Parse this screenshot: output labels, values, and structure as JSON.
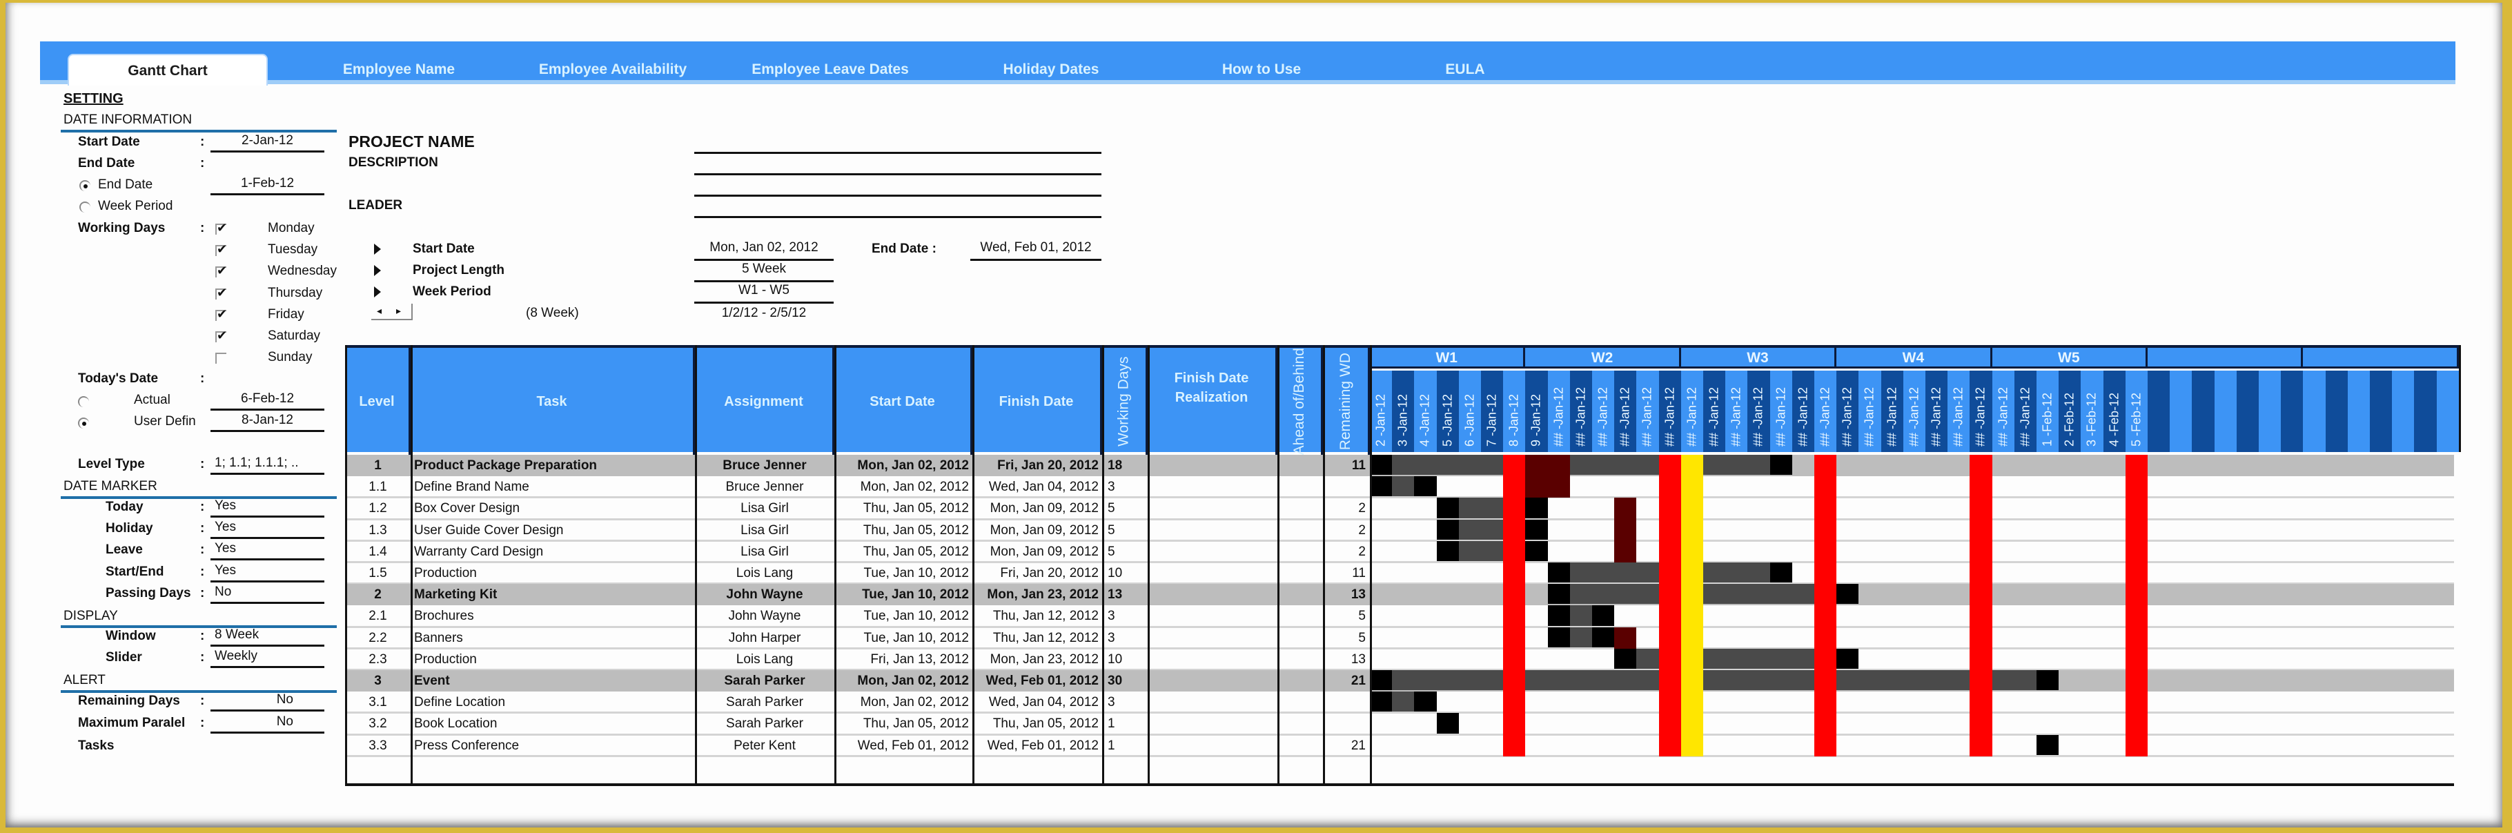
{
  "tabs": [
    {
      "label": "Gantt Chart",
      "active": true
    },
    {
      "label": "Employee Name",
      "active": false
    },
    {
      "label": "Employee Availability",
      "active": false
    },
    {
      "label": "Employee Leave Dates",
      "active": false
    },
    {
      "label": "Holiday Dates",
      "active": false
    },
    {
      "label": "How to Use",
      "active": false
    },
    {
      "label": "EULA",
      "active": false
    }
  ],
  "settings": {
    "title": "SETTING",
    "date_info": {
      "section": "DATE INFORMATION",
      "start_date_label": "Start Date",
      "start_date": "2-Jan-12",
      "end_date_label": "End Date",
      "end_mode_options": [
        {
          "label": "End Date",
          "selected": true
        },
        {
          "label": "Week Period",
          "selected": false
        }
      ],
      "end_date": "1-Feb-12",
      "working_days_label": "Working Days",
      "working_days": [
        {
          "day": "Monday",
          "checked": true
        },
        {
          "day": "Tuesday",
          "checked": true
        },
        {
          "day": "Wednesday",
          "checked": true
        },
        {
          "day": "Thursday",
          "checked": true
        },
        {
          "day": "Friday",
          "checked": true
        },
        {
          "day": "Saturday",
          "checked": true
        },
        {
          "day": "Sunday",
          "checked": false
        }
      ],
      "todays_date_label": "Today's Date",
      "today_options": [
        {
          "label": "Actual",
          "value": "6-Feb-12",
          "selected": false
        },
        {
          "label": "User Defin",
          "value": "8-Jan-12",
          "selected": true
        }
      ],
      "level_type_label": "Level Type",
      "level_type": "1; 1.1; 1.1.1; .."
    },
    "date_marker": {
      "section": "DATE MARKER",
      "items": [
        {
          "label": "Today",
          "value": "Yes"
        },
        {
          "label": "Holiday",
          "value": "Yes"
        },
        {
          "label": "Leave",
          "value": "Yes"
        },
        {
          "label": "Start/End",
          "value": "Yes"
        },
        {
          "label": "Passing Days",
          "value": "No"
        }
      ]
    },
    "display": {
      "section": "DISPLAY",
      "items": [
        {
          "label": "Window",
          "value": "8 Week"
        },
        {
          "label": "Slider",
          "value": "Weekly"
        }
      ]
    },
    "alert": {
      "section": "ALERT",
      "items": [
        {
          "label": "Remaining Days",
          "value": "No"
        },
        {
          "label": "Maximum Paralel",
          "value": "No"
        }
      ],
      "tasks_label": "Tasks"
    },
    "colon": ":"
  },
  "project": {
    "name_label": "PROJECT NAME",
    "description_label": "DESCRIPTION",
    "leader_label": "LEADER",
    "start_date_label": "Start Date",
    "start_date": "Mon, Jan 02, 2012",
    "end_date_label": "End Date :",
    "end_date": "Wed, Feb 01, 2012",
    "length_label": "Project Length",
    "length": "5 Week",
    "week_period_label": "Week Period",
    "week_period": "W1 - W5",
    "window_note": "(8 Week)",
    "window_range": "1/2/12 - 2/5/12",
    "scroll_left": "◂",
    "scroll_right": "▸"
  },
  "table": {
    "headers": {
      "level": "Level",
      "task": "Task",
      "assignment": "Assignment",
      "start": "Start Date",
      "finish": "Finish Date",
      "working_days": "Working Days",
      "finish_realization": "Finish Date Realization",
      "ahead_behind": "Ahead of/Behind",
      "remaining_wd": "Remaining WD"
    },
    "rows": [
      {
        "level": "1",
        "task": "Product Package Preparation",
        "assignment": "Bruce Jenner",
        "start": "Mon, Jan 02, 2012",
        "finish": "Fri, Jan 20, 2012",
        "wd": "18",
        "realization": "",
        "ahead": "",
        "remaining": "11",
        "summary": true
      },
      {
        "level": "1.1",
        "task": "Define Brand Name",
        "assignment": "Bruce Jenner",
        "start": "Mon, Jan 02, 2012",
        "finish": "Wed, Jan 04, 2012",
        "wd": "3",
        "realization": "",
        "ahead": "",
        "remaining": "",
        "summary": false
      },
      {
        "level": "1.2",
        "task": "Box Cover Design",
        "assignment": "Lisa Girl",
        "start": "Thu, Jan 05, 2012",
        "finish": "Mon, Jan 09, 2012",
        "wd": "5",
        "realization": "",
        "ahead": "",
        "remaining": "2",
        "summary": false
      },
      {
        "level": "1.3",
        "task": "User Guide Cover Design",
        "assignment": "Lisa Girl",
        "start": "Thu, Jan 05, 2012",
        "finish": "Mon, Jan 09, 2012",
        "wd": "5",
        "realization": "",
        "ahead": "",
        "remaining": "2",
        "summary": false
      },
      {
        "level": "1.4",
        "task": "Warranty Card Design",
        "assignment": "Lisa Girl",
        "start": "Thu, Jan 05, 2012",
        "finish": "Mon, Jan 09, 2012",
        "wd": "5",
        "realization": "",
        "ahead": "",
        "remaining": "2",
        "summary": false
      },
      {
        "level": "1.5",
        "task": "Production",
        "assignment": "Lois Lang",
        "start": "Tue, Jan 10, 2012",
        "finish": "Fri, Jan 20, 2012",
        "wd": "10",
        "realization": "",
        "ahead": "",
        "remaining": "11",
        "summary": false
      },
      {
        "level": "2",
        "task": "Marketing Kit",
        "assignment": "John Wayne",
        "start": "Tue, Jan 10, 2012",
        "finish": "Mon, Jan 23, 2012",
        "wd": "13",
        "realization": "",
        "ahead": "",
        "remaining": "13",
        "summary": true
      },
      {
        "level": "2.1",
        "task": "Brochures",
        "assignment": "John Wayne",
        "start": "Tue, Jan 10, 2012",
        "finish": "Thu, Jan 12, 2012",
        "wd": "3",
        "realization": "",
        "ahead": "",
        "remaining": "5",
        "summary": false
      },
      {
        "level": "2.2",
        "task": "Banners",
        "assignment": "John Harper",
        "start": "Tue, Jan 10, 2012",
        "finish": "Thu, Jan 12, 2012",
        "wd": "3",
        "realization": "",
        "ahead": "",
        "remaining": "5",
        "summary": false
      },
      {
        "level": "2.3",
        "task": "Production",
        "assignment": "Lois Lang",
        "start": "Fri, Jan 13, 2012",
        "finish": "Mon, Jan 23, 2012",
        "wd": "10",
        "realization": "",
        "ahead": "",
        "remaining": "13",
        "summary": false
      },
      {
        "level": "3",
        "task": "Event",
        "assignment": "Sarah Parker",
        "start": "Mon, Jan 02, 2012",
        "finish": "Wed, Feb 01, 2012",
        "wd": "30",
        "realization": "",
        "ahead": "",
        "remaining": "21",
        "summary": true
      },
      {
        "level": "3.1",
        "task": "Define Location",
        "assignment": "Sarah Parker",
        "start": "Mon, Jan 02, 2012",
        "finish": "Wed, Jan 04, 2012",
        "wd": "3",
        "realization": "",
        "ahead": "",
        "remaining": "",
        "summary": false
      },
      {
        "level": "3.2",
        "task": "Book Location",
        "assignment": "Sarah Parker",
        "start": "Thu, Jan 05, 2012",
        "finish": "Thu, Jan 05, 2012",
        "wd": "1",
        "realization": "",
        "ahead": "",
        "remaining": "",
        "summary": false
      },
      {
        "level": "3.3",
        "task": "Press Conference",
        "assignment": "Peter Kent",
        "start": "Wed, Feb 01, 2012",
        "finish": "Wed, Feb 01, 2012",
        "wd": "1",
        "realization": "",
        "ahead": "",
        "remaining": "21",
        "summary": false
      }
    ]
  },
  "gantt": {
    "weeks": [
      "W1",
      "W2",
      "W3",
      "W4",
      "W5",
      "",
      ""
    ],
    "days": [
      "2 -Jan-12",
      "3 -Jan-12",
      "4 -Jan-12",
      "5 -Jan-12",
      "6 -Jan-12",
      "7 -Jan-12",
      "8 -Jan-12",
      "9 -Jan-12",
      "## -Jan-12",
      "## -Jan-12",
      "## -Jan-12",
      "## -Jan-12",
      "## -Jan-12",
      "## -Jan-12",
      "## -Jan-12",
      "## -Jan-12",
      "## -Jan-12",
      "## -Jan-12",
      "## -Jan-12",
      "## -Jan-12",
      "## -Jan-12",
      "## -Jan-12",
      "## -Jan-12",
      "## -Jan-12",
      "## -Jan-12",
      "## -Jan-12",
      "## -Jan-12",
      "## -Jan-12",
      "## -Jan-12",
      "## -Jan-12",
      "1 -Feb-12",
      "2 -Feb-12",
      "3 -Feb-12",
      "4 -Feb-12",
      "5 -Feb-12",
      "",
      "",
      "",
      "",
      "",
      "",
      "",
      "",
      "",
      "",
      "",
      "",
      "",
      ""
    ],
    "colors": {
      "header_light": "#3d94f5",
      "header_dark": "#0f4c9a",
      "start_end": "#000000",
      "progress": "#4a4a4a",
      "summary_bg": "#bdbdbd",
      "sunday": "#ff0000",
      "holiday": "#ffe600",
      "leave": "#5a0000"
    },
    "sunday_day_indexes": [
      6,
      13,
      20,
      27,
      34
    ],
    "holiday_day_indexes": [
      14
    ],
    "bars": [
      {
        "row": 0,
        "segments": [
          [
            0,
            0,
            "start_end"
          ],
          [
            1,
            5,
            "progress"
          ],
          [
            9,
            12,
            "progress"
          ],
          [
            15,
            17,
            "progress"
          ],
          [
            18,
            18,
            "start_end"
          ]
        ]
      },
      {
        "row": 1,
        "segments": [
          [
            0,
            0,
            "start_end"
          ],
          [
            1,
            1,
            "progress"
          ],
          [
            2,
            2,
            "start_end"
          ]
        ]
      },
      {
        "row": 2,
        "segments": [
          [
            3,
            3,
            "start_end"
          ],
          [
            4,
            5,
            "progress"
          ],
          [
            7,
            7,
            "start_end"
          ]
        ]
      },
      {
        "row": 3,
        "segments": [
          [
            3,
            3,
            "start_end"
          ],
          [
            4,
            5,
            "progress"
          ],
          [
            7,
            7,
            "start_end"
          ]
        ]
      },
      {
        "row": 4,
        "segments": [
          [
            3,
            3,
            "start_end"
          ],
          [
            4,
            5,
            "progress"
          ],
          [
            7,
            7,
            "start_end"
          ]
        ]
      },
      {
        "row": 5,
        "segments": [
          [
            8,
            8,
            "start_end"
          ],
          [
            9,
            12,
            "progress"
          ],
          [
            15,
            17,
            "progress"
          ],
          [
            18,
            18,
            "start_end"
          ]
        ]
      },
      {
        "row": 6,
        "segments": [
          [
            8,
            8,
            "start_end"
          ],
          [
            9,
            12,
            "progress"
          ],
          [
            15,
            19,
            "progress"
          ],
          [
            21,
            21,
            "start_end"
          ]
        ]
      },
      {
        "row": 7,
        "segments": [
          [
            8,
            8,
            "start_end"
          ],
          [
            9,
            9,
            "progress"
          ],
          [
            10,
            10,
            "start_end"
          ]
        ]
      },
      {
        "row": 8,
        "segments": [
          [
            8,
            8,
            "start_end"
          ],
          [
            9,
            9,
            "progress"
          ],
          [
            10,
            10,
            "start_end"
          ]
        ]
      },
      {
        "row": 9,
        "segments": [
          [
            11,
            11,
            "start_end"
          ],
          [
            12,
            12,
            "progress"
          ],
          [
            15,
            19,
            "progress"
          ],
          [
            21,
            21,
            "start_end"
          ]
        ]
      },
      {
        "row": 10,
        "segments": [
          [
            0,
            0,
            "start_end"
          ],
          [
            1,
            5,
            "progress"
          ],
          [
            7,
            12,
            "progress"
          ],
          [
            15,
            19,
            "progress"
          ],
          [
            21,
            26,
            "progress"
          ],
          [
            28,
            29,
            "progress"
          ],
          [
            30,
            30,
            "start_end"
          ]
        ]
      },
      {
        "row": 11,
        "segments": [
          [
            0,
            0,
            "start_end"
          ],
          [
            1,
            1,
            "progress"
          ],
          [
            2,
            2,
            "start_end"
          ]
        ]
      },
      {
        "row": 12,
        "segments": [
          [
            3,
            3,
            "start_end"
          ]
        ]
      },
      {
        "row": 13,
        "segments": [
          [
            30,
            30,
            "start_end"
          ]
        ]
      }
    ],
    "leave_marks": [
      {
        "rows": [
          0,
          1
        ],
        "days": [
          7,
          8
        ]
      },
      {
        "rows": [
          2,
          4
        ],
        "days": [
          11,
          11
        ]
      },
      {
        "rows": [
          8,
          8
        ],
        "days": [
          11,
          11
        ]
      }
    ]
  }
}
